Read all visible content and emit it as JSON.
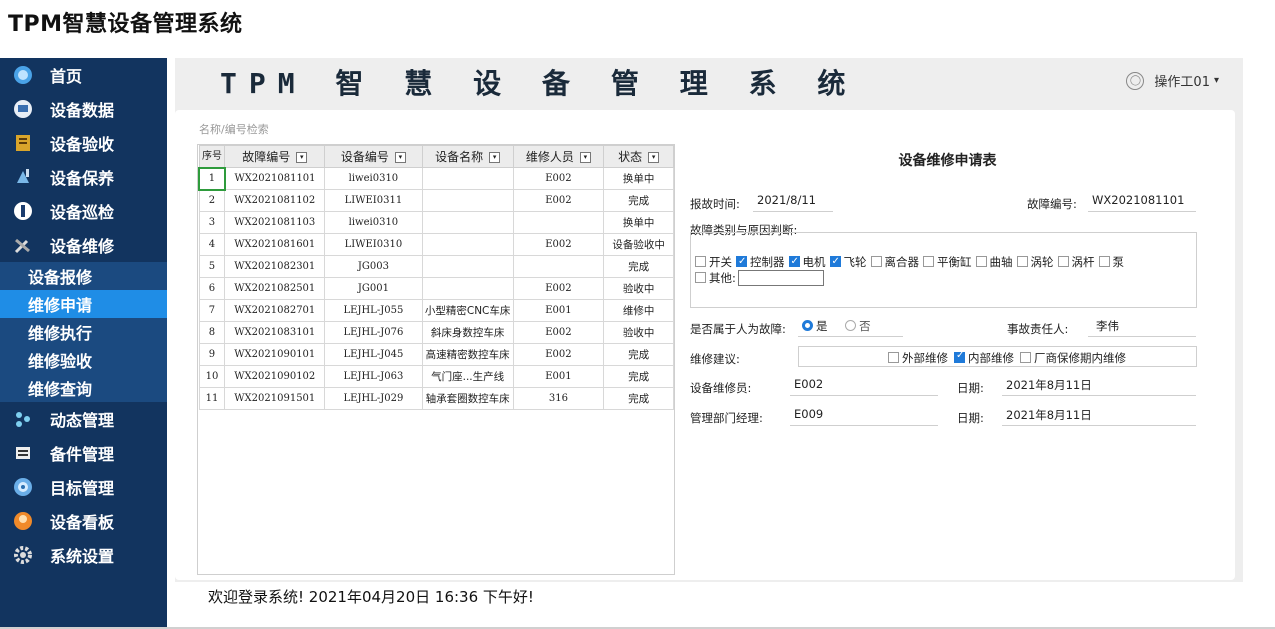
{
  "app_title": "TPM智慧设备管理系统",
  "header": {
    "banner_title": "TPM 智 慧 设 备 管 理 系 统",
    "user_name": "操作工01",
    "user_caret": "▾"
  },
  "sidebar": {
    "items": [
      {
        "label": "首页",
        "icon": "home-icon"
      },
      {
        "label": "设备数据",
        "icon": "data-icon"
      },
      {
        "label": "设备验收",
        "icon": "acceptance-icon"
      },
      {
        "label": "设备保养",
        "icon": "maintenance-icon"
      },
      {
        "label": "设备巡检",
        "icon": "inspection-icon"
      },
      {
        "label": "设备维修",
        "icon": "repair-icon"
      }
    ],
    "sub_items": [
      "设备报修",
      "维修申请",
      "维修执行",
      "维修验收",
      "维修查询"
    ],
    "active_sub": "维修申请",
    "items_after": [
      {
        "label": "动态管理",
        "icon": "dynamic-icon"
      },
      {
        "label": "备件管理",
        "icon": "spare-parts-icon"
      },
      {
        "label": "目标管理",
        "icon": "target-icon"
      },
      {
        "label": "设备看板",
        "icon": "dashboard-icon"
      },
      {
        "label": "系统设置",
        "icon": "settings-icon"
      }
    ]
  },
  "search": {
    "label": "名称/编号检索"
  },
  "table": {
    "headers": [
      "序号",
      "故障编号",
      "设备编号",
      "设备名称",
      "维修人员",
      "状态"
    ],
    "rows": [
      [
        "1",
        "WX2021081101",
        "liwei0310",
        "",
        "E002",
        "换单中"
      ],
      [
        "2",
        "WX2021081102",
        "LIWEI0311",
        "",
        "E002",
        "完成"
      ],
      [
        "3",
        "WX2021081103",
        "liwei0310",
        "",
        "",
        "换单中"
      ],
      [
        "4",
        "WX2021081601",
        "LIWEI0310",
        "",
        "E002",
        "设备验收中"
      ],
      [
        "5",
        "WX2021082301",
        "JG003",
        "",
        "",
        "完成"
      ],
      [
        "6",
        "WX2021082501",
        "JG001",
        "",
        "E002",
        "验收中"
      ],
      [
        "7",
        "WX2021082701",
        "LEJHL-J055",
        "小型精密CNC车床",
        "E001",
        "维修中"
      ],
      [
        "8",
        "WX2021083101",
        "LEJHL-J076",
        "斜床身数控车床",
        "E002",
        "验收中"
      ],
      [
        "9",
        "WX2021090101",
        "LEJHL-J045",
        "高速精密数控车床",
        "E002",
        "完成"
      ],
      [
        "10",
        "WX2021090102",
        "LEJHL-J063",
        "气门座...生产线",
        "E001",
        "完成"
      ],
      [
        "11",
        "WX2021091501",
        "LEJHL-J029",
        "轴承套圈数控车床",
        "316",
        "完成"
      ]
    ]
  },
  "form": {
    "title": "设备维修申请表",
    "report_time_label": "报故时间:",
    "report_time_value": "2021/8/11",
    "fault_no_label": "故障编号:",
    "fault_no_value": "WX2021081101",
    "category_label": "故障类别与原因判断:",
    "categories": [
      {
        "label": "开关",
        "checked": false
      },
      {
        "label": "控制器",
        "checked": true
      },
      {
        "label": "电机",
        "checked": true
      },
      {
        "label": "飞轮",
        "checked": true
      },
      {
        "label": "离合器",
        "checked": false
      },
      {
        "label": "平衡缸",
        "checked": false
      },
      {
        "label": "曲轴",
        "checked": false
      },
      {
        "label": "涡轮",
        "checked": false
      },
      {
        "label": "涡杆",
        "checked": false
      },
      {
        "label": "泵",
        "checked": false
      }
    ],
    "other_label": "其他:",
    "human_fault_label": "是否属于人为故障:",
    "human_yes": "是",
    "human_no": "否",
    "human_selected": "是",
    "responsible_label": "事故责任人:",
    "responsible_value": "李伟",
    "suggestion_label": "维修建议:",
    "suggestions": [
      {
        "label": "外部维修",
        "checked": false
      },
      {
        "label": "内部维修",
        "checked": true
      },
      {
        "label": "厂商保修期内维修",
        "checked": false
      }
    ],
    "repairer_label": "设备维修员:",
    "repairer_value": "E002",
    "date1_label": "日期:",
    "date1_value": "2021年8月11日",
    "manager_label": "管理部门经理:",
    "manager_value": "E009",
    "date2_label": "日期:",
    "date2_value": "2021年8月11日"
  },
  "footer": {
    "welcome": "欢迎登录系统!  2021年04月20日 16:36 下午好!"
  }
}
